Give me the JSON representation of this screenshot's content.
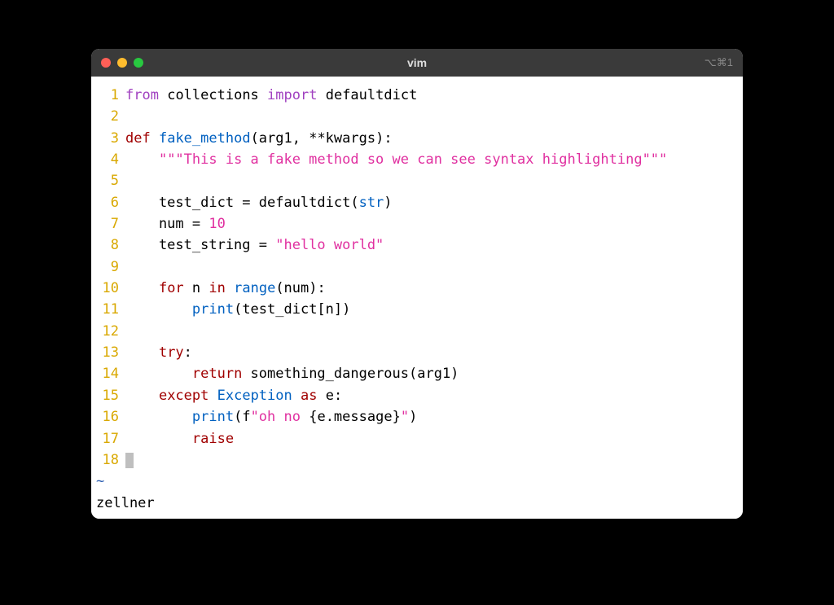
{
  "window": {
    "title": "vim",
    "right_label": "⌥⌘1"
  },
  "status": "zellner",
  "lines": [
    {
      "n": "1",
      "tokens": [
        {
          "t": "from",
          "c": "c-import"
        },
        {
          "t": " ",
          "c": "c-black"
        },
        {
          "t": "collections",
          "c": "c-black"
        },
        {
          "t": " ",
          "c": "c-black"
        },
        {
          "t": "import",
          "c": "c-import"
        },
        {
          "t": " ",
          "c": "c-black"
        },
        {
          "t": "defaultdict",
          "c": "c-black"
        }
      ]
    },
    {
      "n": "2",
      "tokens": []
    },
    {
      "n": "3",
      "tokens": [
        {
          "t": "def",
          "c": "c-keyword"
        },
        {
          "t": " ",
          "c": "c-black"
        },
        {
          "t": "fake_method",
          "c": "c-funcdef"
        },
        {
          "t": "(arg1, **kwargs):",
          "c": "c-black"
        }
      ]
    },
    {
      "n": "4",
      "tokens": [
        {
          "t": "    ",
          "c": "c-black"
        },
        {
          "t": "\"\"\"This is a fake method so we can see syntax highlighting\"\"\"",
          "c": "c-magenta"
        }
      ]
    },
    {
      "n": "5",
      "tokens": []
    },
    {
      "n": "6",
      "tokens": [
        {
          "t": "    test_dict = defaultdict(",
          "c": "c-black"
        },
        {
          "t": "str",
          "c": "c-builtin"
        },
        {
          "t": ")",
          "c": "c-black"
        }
      ]
    },
    {
      "n": "7",
      "tokens": [
        {
          "t": "    num = ",
          "c": "c-black"
        },
        {
          "t": "10",
          "c": "c-number"
        }
      ]
    },
    {
      "n": "8",
      "tokens": [
        {
          "t": "    test_string = ",
          "c": "c-black"
        },
        {
          "t": "\"hello world\"",
          "c": "c-magenta"
        }
      ]
    },
    {
      "n": "9",
      "tokens": []
    },
    {
      "n": "10",
      "tokens": [
        {
          "t": "    ",
          "c": "c-black"
        },
        {
          "t": "for",
          "c": "c-keyword"
        },
        {
          "t": " n ",
          "c": "c-black"
        },
        {
          "t": "in",
          "c": "c-keyword"
        },
        {
          "t": " ",
          "c": "c-black"
        },
        {
          "t": "range",
          "c": "c-builtin"
        },
        {
          "t": "(num):",
          "c": "c-black"
        }
      ]
    },
    {
      "n": "11",
      "tokens": [
        {
          "t": "        ",
          "c": "c-black"
        },
        {
          "t": "print",
          "c": "c-builtin"
        },
        {
          "t": "(test_dict[n])",
          "c": "c-black"
        }
      ]
    },
    {
      "n": "12",
      "tokens": []
    },
    {
      "n": "13",
      "tokens": [
        {
          "t": "    ",
          "c": "c-black"
        },
        {
          "t": "try",
          "c": "c-keyword"
        },
        {
          "t": ":",
          "c": "c-black"
        }
      ]
    },
    {
      "n": "14",
      "tokens": [
        {
          "t": "        ",
          "c": "c-black"
        },
        {
          "t": "return",
          "c": "c-keyword"
        },
        {
          "t": " something_dangerous(arg1)",
          "c": "c-black"
        }
      ]
    },
    {
      "n": "15",
      "tokens": [
        {
          "t": "    ",
          "c": "c-black"
        },
        {
          "t": "except",
          "c": "c-keyword"
        },
        {
          "t": " ",
          "c": "c-black"
        },
        {
          "t": "Exception",
          "c": "c-builtin"
        },
        {
          "t": " ",
          "c": "c-black"
        },
        {
          "t": "as",
          "c": "c-keyword"
        },
        {
          "t": " e:",
          "c": "c-black"
        }
      ]
    },
    {
      "n": "16",
      "tokens": [
        {
          "t": "        ",
          "c": "c-black"
        },
        {
          "t": "print",
          "c": "c-builtin"
        },
        {
          "t": "(f",
          "c": "c-black"
        },
        {
          "t": "\"oh no ",
          "c": "c-magenta"
        },
        {
          "t": "{e.message}",
          "c": "c-black"
        },
        {
          "t": "\"",
          "c": "c-magenta"
        },
        {
          "t": ")",
          "c": "c-black"
        }
      ]
    },
    {
      "n": "17",
      "tokens": [
        {
          "t": "        ",
          "c": "c-black"
        },
        {
          "t": "raise",
          "c": "c-keyword"
        }
      ]
    },
    {
      "n": "18",
      "tokens": [],
      "cursor": true
    }
  ],
  "tilde": "~"
}
